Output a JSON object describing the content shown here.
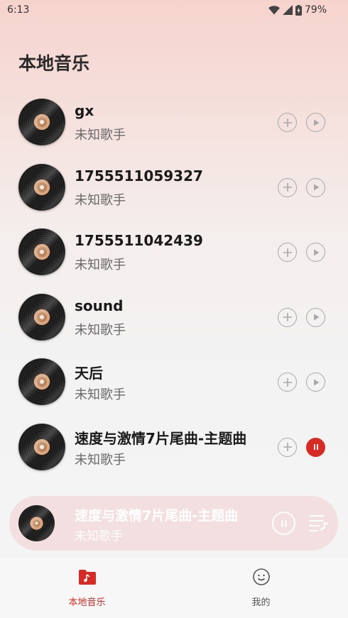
{
  "status_bar": {
    "time": "6:13",
    "battery": "79%",
    "icons": [
      "wifi-icon",
      "signal-icon",
      "battery-icon"
    ]
  },
  "header": {
    "title": "本地音乐"
  },
  "songs": [
    {
      "title": "gx",
      "artist": "未知歌手",
      "playing": false
    },
    {
      "title": "1755511059327",
      "artist": "未知歌手",
      "playing": false
    },
    {
      "title": "1755511042439",
      "artist": "未知歌手",
      "playing": false
    },
    {
      "title": "sound",
      "artist": "未知歌手",
      "playing": false
    },
    {
      "title": "天后",
      "artist": "未知歌手",
      "playing": false
    },
    {
      "title": "速度与激情7片尾曲-主题曲",
      "artist": "未知歌手",
      "playing": true
    }
  ],
  "mini_player": {
    "title": "速度与激情7片尾曲-主题曲",
    "artist": "未知歌手"
  },
  "bottom_nav": {
    "items": [
      {
        "label": "本地音乐",
        "icon": "music-folder-icon",
        "active": true
      },
      {
        "label": "我的",
        "icon": "smiley-face-icon",
        "active": false
      }
    ]
  },
  "colors": {
    "accent": "#d62b25",
    "icon_gray": "#a8a8a8"
  }
}
